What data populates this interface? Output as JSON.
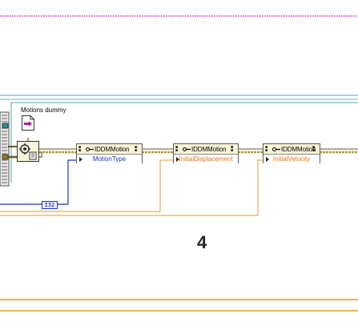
{
  "diagram": {
    "motions_label": "Motions dummy",
    "constant_label": "I32",
    "step_number": "4",
    "nodes": [
      {
        "class_name": "IDDMMotion",
        "property": "MotionType",
        "property_color": "#1a32c8"
      },
      {
        "class_name": "IDDMMotion",
        "property": "InitialDisplacement",
        "property_color": "#e8731c"
      },
      {
        "class_name": "IDDMMotion",
        "property": "InitialVelocity",
        "property_color": "#e8731c"
      }
    ],
    "colors": {
      "class_wire": "#6b5a2a",
      "int_wire": "#1a32c8",
      "dbl_wire": "#f0932b",
      "frame": "#6fb6b9",
      "top_dashed": "#cc22cc"
    },
    "icons": {
      "constant": "motions-constant-icon",
      "vi": "vi-subroutine-icon",
      "node": "property-node-icon"
    }
  }
}
